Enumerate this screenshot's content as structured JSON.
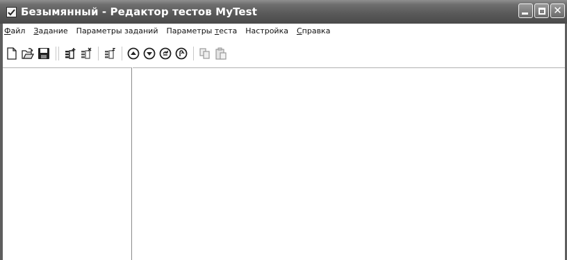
{
  "window": {
    "title": "Безымянный - Редактор тестов MyTest",
    "title_bar_color": "#585858"
  },
  "window_buttons": {
    "minimize_icon": "minimize-icon",
    "maximize_icon": "maximize-icon",
    "close_icon": "close-icon",
    "close_glyph": "✕"
  },
  "menu": {
    "items": [
      {
        "label": "Файл",
        "mnemonic": "Ф"
      },
      {
        "label": "Задание",
        "mnemonic": "З"
      },
      {
        "label": "Параметры заданий",
        "mnemonic": ""
      },
      {
        "label": "Параметры теста",
        "mnemonic": "т"
      },
      {
        "label": "Настройка",
        "mnemonic": ""
      },
      {
        "label": "Справка",
        "mnemonic": "С"
      }
    ]
  },
  "toolbar": {
    "buttons": [
      {
        "icon": "new-file-icon",
        "enabled": true
      },
      {
        "icon": "open-folder-icon",
        "enabled": true
      },
      {
        "icon": "save-icon",
        "enabled": true
      },
      {
        "icon": "add-task-icon",
        "enabled": true
      },
      {
        "icon": "delete-task-icon",
        "enabled": true
      },
      {
        "icon": "task-properties-icon",
        "enabled": true
      },
      {
        "icon": "move-up-icon",
        "enabled": true
      },
      {
        "icon": "move-down-icon",
        "enabled": true
      },
      {
        "icon": "move-next-icon",
        "enabled": true
      },
      {
        "icon": "move-back-icon",
        "enabled": true
      },
      {
        "icon": "copy-icon",
        "enabled": false
      },
      {
        "icon": "paste-icon",
        "enabled": false
      }
    ]
  }
}
